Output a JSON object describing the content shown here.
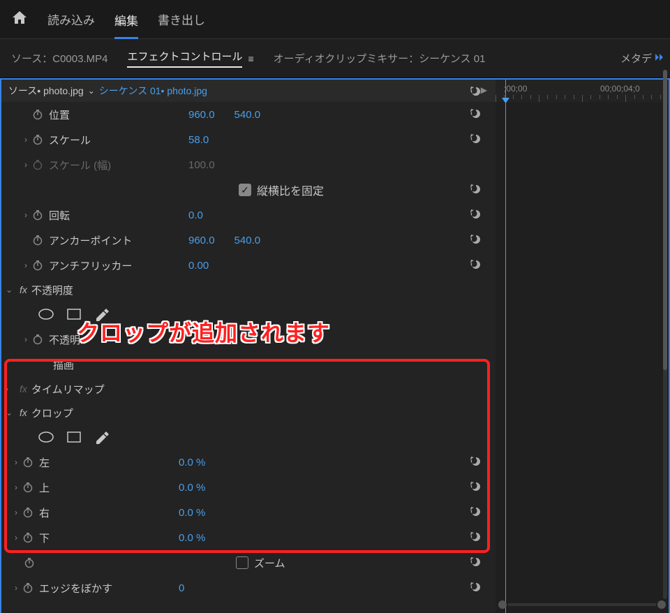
{
  "nav": {
    "import": "読み込み",
    "edit": "編集",
    "export": "書き出し"
  },
  "panels": {
    "source": "ソース：C0003.MP4",
    "effect_controls": "エフェクトコントロール",
    "audio_mixer": "オーディオクリップミキサー：シーケンス 01",
    "metadata": "メタデ"
  },
  "clip": {
    "source": "ソース• photo.jpg",
    "sequence": "シーケンス 01• photo.jpg"
  },
  "timeline": {
    "t0": ";00;00",
    "t1": "00;00;04;0"
  },
  "motion": {
    "position": {
      "label": "位置",
      "x": "960.0",
      "y": "540.0"
    },
    "scale": {
      "label": "スケール",
      "value": "58.0"
    },
    "scale_w": {
      "label": "スケール (幅)",
      "value": "100.0"
    },
    "uniform": "縦横比を固定",
    "rotation": {
      "label": "回転",
      "value": "0.0"
    },
    "anchor": {
      "label": "アンカーポイント",
      "x": "960.0",
      "y": "540.0"
    },
    "antiflicker": {
      "label": "アンチフリッカー",
      "value": "0.00"
    }
  },
  "opacity": {
    "section": "不透明度",
    "label": "不透明",
    "mode": "描画"
  },
  "timeremap": "タイムリマップ",
  "crop": {
    "section": "クロップ",
    "left": {
      "label": "左",
      "value": "0.0 %"
    },
    "top": {
      "label": "上",
      "value": "0.0 %"
    },
    "right": {
      "label": "右",
      "value": "0.0 %"
    },
    "bottom": {
      "label": "下",
      "value": "0.0 %"
    },
    "zoom": "ズーム",
    "edge": {
      "label": "エッジをぼかす",
      "value": "0"
    }
  },
  "annotation": "クロップが追加されます"
}
